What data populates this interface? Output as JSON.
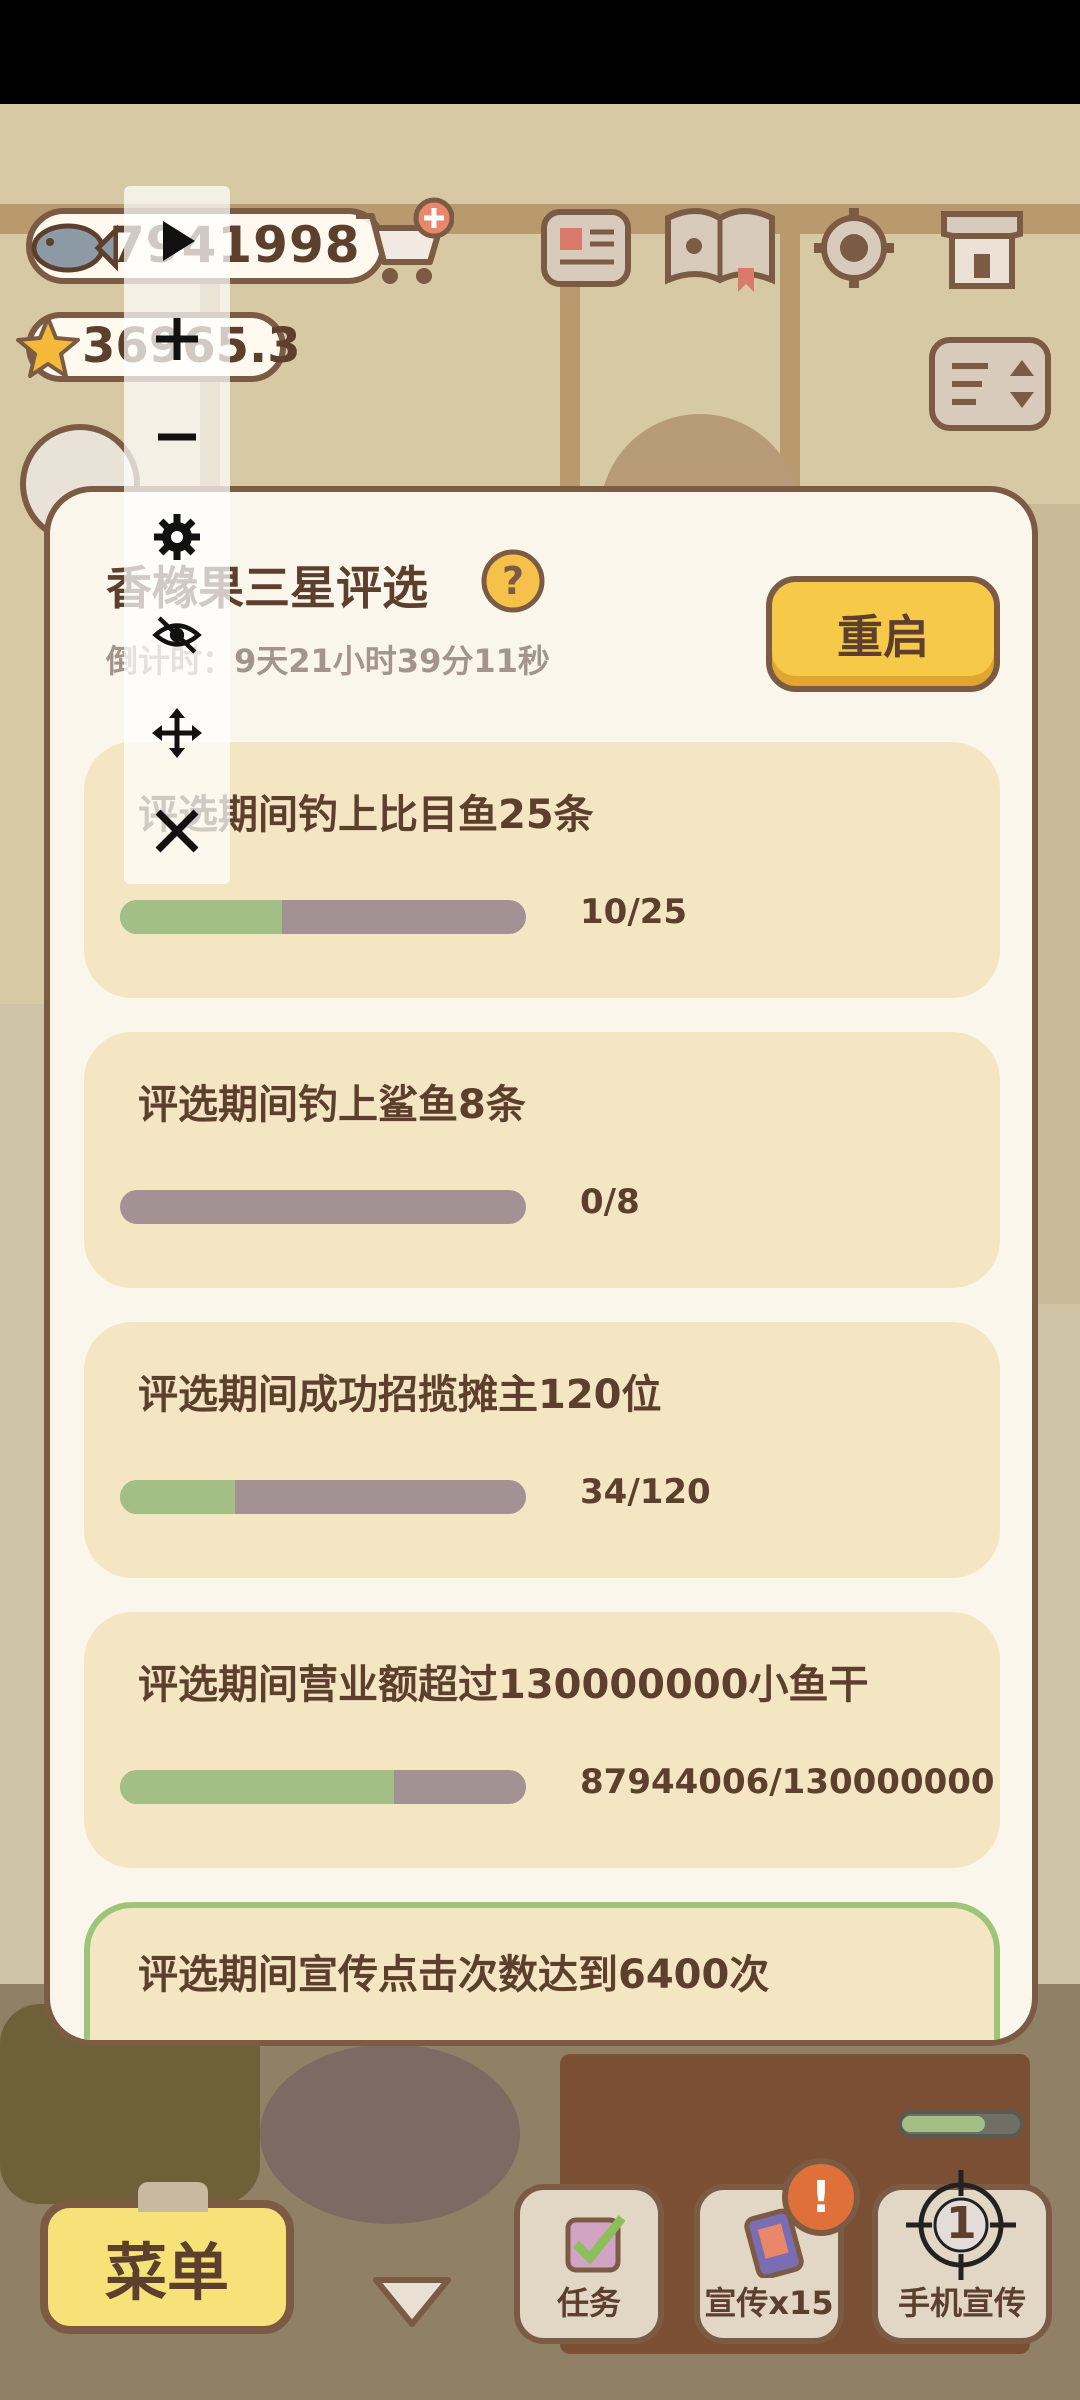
{
  "hud": {
    "fish_count": "7941998",
    "star_count": "36965.3"
  },
  "tool_panel": {
    "icons": [
      "play-icon",
      "plus-icon",
      "minus-icon",
      "gear-icon",
      "eye-off-icon",
      "move-icon",
      "close-icon"
    ]
  },
  "modal": {
    "title": "香橼果三星评选",
    "countdown": "倒计时：9天21小时39分11秒",
    "restart_label": "重启",
    "tasks": [
      {
        "text": "评选期间钓上比目鱼25条",
        "count": "10/25",
        "progress": 0.4
      },
      {
        "text": "评选期间钓上鲨鱼8条",
        "count": "0/8",
        "progress": 0
      },
      {
        "text": "评选期间成功招揽摊主120位",
        "count": "34/120",
        "progress": 0.283
      },
      {
        "text": "评选期间营业额超过130000000小鱼干",
        "count": "87944006/130000000",
        "progress": 0.676
      },
      {
        "text": "评选期间宣传点击次数达到6400次",
        "count": "",
        "progress": 0
      }
    ]
  },
  "bottom": {
    "menu_label": "菜单",
    "task_label": "任务",
    "promo_label": "宣传x15",
    "phone_promo_label": "手机宣传",
    "alert_badge": "!",
    "target_number": "1",
    "promo_energy": 0.7
  },
  "colors": {
    "brown": "#5c3f2c",
    "progress_green": "#a3bf86",
    "progress_track": "#a29294",
    "task_card": "#f5e6c3",
    "restart_yellow": "#f7c948"
  }
}
